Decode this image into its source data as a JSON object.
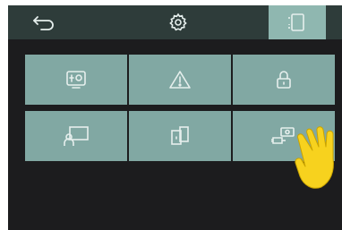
{
  "colors": {
    "screen_bg": "#1c1c1e",
    "topbar_bg": "#2e3c3a",
    "tile_bg": "#81a8a3",
    "tile_active": "#8fb7b0",
    "icon_stroke": "#e6efed",
    "hand_fill": "#f7d21e"
  },
  "topbar": {
    "back_icon": "back-arrow-icon",
    "settings_icon": "gear-icon",
    "active_tab_icon": "rotate-device-icon"
  },
  "tiles": [
    {
      "icon": "diagnostics-panel-icon"
    },
    {
      "icon": "warning-triangle-icon"
    },
    {
      "icon": "padlock-icon"
    },
    {
      "icon": "user-screen-icon"
    },
    {
      "icon": "door-panel-icon"
    },
    {
      "icon": "camera-plug-icon"
    }
  ]
}
